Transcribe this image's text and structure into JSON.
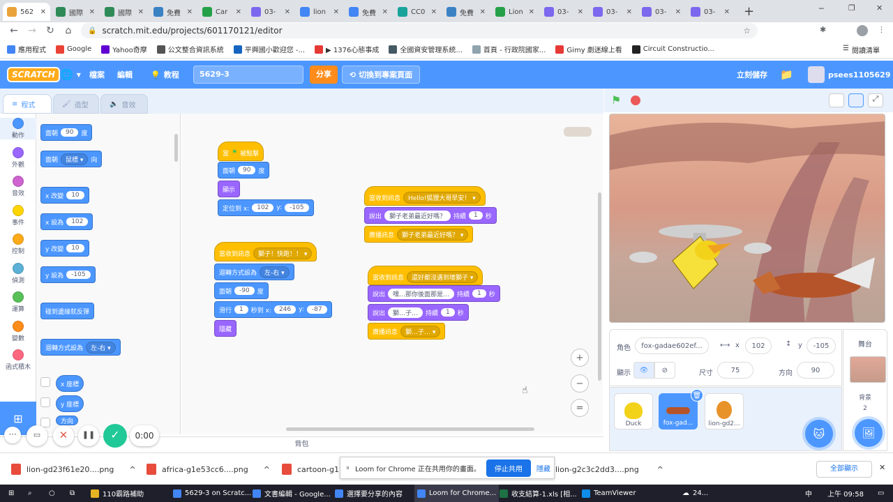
{
  "browser": {
    "tabs": [
      {
        "label": "562",
        "fav": "#e9a23b",
        "active": true
      },
      {
        "label": "國際",
        "fav": "#2e8b57"
      },
      {
        "label": "國際",
        "fav": "#2e8b57"
      },
      {
        "label": "免費",
        "fav": "#3b82c4"
      },
      {
        "label": "Car",
        "fav": "#24a148"
      },
      {
        "label": "03-",
        "fav": "#7b68ee"
      },
      {
        "label": "lion",
        "fav": "#4285f4"
      },
      {
        "label": "免費",
        "fav": "#4285f4"
      },
      {
        "label": "CC0",
        "fav": "#1aa39a"
      },
      {
        "label": "免費",
        "fav": "#3b82c4"
      },
      {
        "label": "Lion",
        "fav": "#24a148"
      },
      {
        "label": "03-",
        "fav": "#7b68ee"
      },
      {
        "label": "03-",
        "fav": "#7b68ee"
      },
      {
        "label": "03-",
        "fav": "#7b68ee"
      },
      {
        "label": "03-",
        "fav": "#7b68ee"
      }
    ],
    "url": "scratch.mit.edu/projects/601170121/editor",
    "bookmarks": [
      {
        "label": "應用程式",
        "c": "#4285f4"
      },
      {
        "label": "Google",
        "c": "#ea4335"
      },
      {
        "label": "Yahoo奇摩",
        "c": "#6001d2"
      },
      {
        "label": "公文整合資訊系統",
        "c": "#555555"
      },
      {
        "label": "平興國小歡迎您 -...",
        "c": "#1565c0"
      },
      {
        "label": "▶ 1376心態事成",
        "c": "#e53935"
      },
      {
        "label": "全國資安管理系統...",
        "c": "#455a64"
      },
      {
        "label": "首頁 - 行政院國家...",
        "c": "#90a4ae"
      },
      {
        "label": "Gimy 劇迷線上看",
        "c": "#e53935"
      },
      {
        "label": "Circuit Constructio...",
        "c": "#222222"
      }
    ],
    "reading_list": "閱讀清單"
  },
  "menu": {
    "file": "檔案",
    "edit": "編輯",
    "tutorial": "教程",
    "project_title": "5629-3",
    "share": "分享",
    "see_project": "切換到專案頁面",
    "save_now": "立刻儲存",
    "username": "psees1105629"
  },
  "editor": {
    "tabs": {
      "code": "程式",
      "costumes": "造型",
      "sounds": "音效"
    },
    "backpack": "背包"
  },
  "categories": [
    {
      "label": "動作",
      "color": "#4c97ff"
    },
    {
      "label": "外觀",
      "color": "#9966ff"
    },
    {
      "label": "音效",
      "color": "#cf63cf"
    },
    {
      "label": "事件",
      "color": "#ffd500"
    },
    {
      "label": "控制",
      "color": "#ffab19"
    },
    {
      "label": "偵測",
      "color": "#5cb1d6"
    },
    {
      "label": "運算",
      "color": "#59c059"
    },
    {
      "label": "變數",
      "color": "#ff8c1a"
    },
    {
      "label": "函式積木",
      "color": "#ff6680"
    }
  ],
  "palette": {
    "b1": {
      "t": "面朝",
      "v": "90",
      "u": "度"
    },
    "b2": {
      "t": "面朝",
      "d": "鼠標",
      "u": "向"
    },
    "b3": {
      "t": "x 改變",
      "v": "10"
    },
    "b4": {
      "t": "x 設為",
      "v": "102"
    },
    "b5": {
      "t": "y 改變",
      "v": "10"
    },
    "b6": {
      "t": "y 設為",
      "v": "-105"
    },
    "b7": {
      "t": "碰到邊緣就反彈"
    },
    "b8": {
      "t": "迴轉方式設為",
      "d": "左-右"
    },
    "r1": "x 座標",
    "r2": "y 座標",
    "r3": "方向"
  },
  "script1": {
    "hat_when": "當",
    "hat_clicked": "被點擊",
    "dir": "面朝",
    "dir_v": "90",
    "dir_u": "度",
    "show": "顯示",
    "goto": "定位到 x:",
    "x": "102",
    "y_lbl": "y:",
    "y": "-105"
  },
  "script2": {
    "hat": "當收到訊息",
    "msg": "獅子！快跑！！",
    "rot": "迴轉方式設為",
    "rot_v": "左-右",
    "dir": "面朝",
    "dir_v": "-90",
    "dir_u": "度",
    "glide": "滑行",
    "glide_s": "1",
    "glide_to": "秒到 x:",
    "gx": "246",
    "gy_lbl": "y:",
    "gy": "-87",
    "hide": "隱藏"
  },
  "script3": {
    "hat": "當收到訊息",
    "msg": "Hello!狐狸大哥早安！",
    "say": "說出",
    "say_v": "獅子老弟最近好嗎？",
    "for": "持續",
    "secs": "1",
    "sec_u": "秒",
    "bc": "廣播訊息",
    "bc_v": "獅子老弟最近好嗎？"
  },
  "script4": {
    "hat": "當收到訊息",
    "msg": "還好都沒遇到壞獅子",
    "say": "說出",
    "say_v": "嘿…那你後面那是…",
    "for": "持續",
    "secs": "1",
    "sec_u": "秒",
    "say2_v": "獅…子…",
    "for2": "持續",
    "secs2": "1",
    "sec2_u": "秒",
    "bc": "廣播訊息",
    "bc_v": "獅…子…"
  },
  "sprite": {
    "label": "角色",
    "name": "fox-gadae602ef...",
    "x_lbl": "x",
    "x": "102",
    "y_lbl": "y",
    "y": "-105",
    "show_lbl": "顯示",
    "size_lbl": "尺寸",
    "size": "75",
    "dir_lbl": "方向",
    "dir": "90"
  },
  "sprites": [
    {
      "name": "Duck"
    },
    {
      "name": "fox-gad..."
    },
    {
      "name": "lion-gd2..."
    }
  ],
  "stage_panel": {
    "title": "舞台",
    "bg_lbl": "背景",
    "bg_count": "2"
  },
  "loom": {
    "timer": "0:00"
  },
  "downloads": {
    "items": [
      "lion-gd23f61e20....png",
      "africa-g1e53cc6....png",
      "cartoon-g1",
      "lion-g2c3c2dd3....png"
    ],
    "show_all": "全部顯示"
  },
  "share_bar": {
    "text": "Loom for Chrome 正在共用你的畫面。",
    "stop": "停止共用",
    "hide": "隱藏"
  },
  "taskbar": {
    "items": [
      {
        "label": "110霸路補助",
        "c": "#e6b422"
      },
      {
        "label": "5629-3 on Scratc...",
        "c": "#4285f4"
      },
      {
        "label": "文書編輯 - Google...",
        "c": "#4285f4"
      },
      {
        "label": "選擇要分享的內容",
        "c": "#4285f4"
      },
      {
        "label": "Loom for Chrome...",
        "c": "#4285f4"
      },
      {
        "label": "收支結算-1.xls [相...",
        "c": "#1e7145"
      },
      {
        "label": "TeamViewer",
        "c": "#0e8ee9"
      }
    ],
    "weather": "24...",
    "ime": "中",
    "clock": "上午 09:58"
  }
}
